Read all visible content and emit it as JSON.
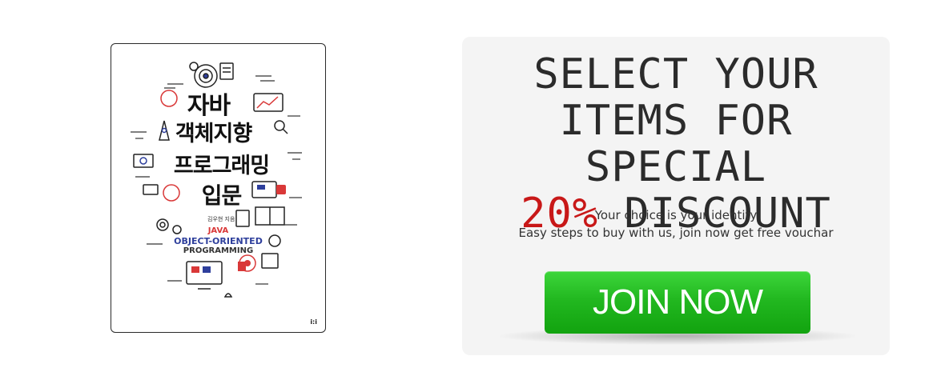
{
  "book": {
    "title_lines": [
      "자바",
      "객체지향",
      "프로그래밍",
      "입문"
    ],
    "author": "김우현 지음",
    "subtitle_lines": [
      "JAVA",
      "OBJECT-ORIENTED",
      "PROGRAMMING"
    ],
    "publisher_logo": "i:i",
    "colors": {
      "accent_red": "#d93838",
      "accent_blue": "#2e3f9c",
      "ink": "#111111"
    }
  },
  "promo": {
    "headline": {
      "line1": "SELECT YOUR",
      "line2": "ITEMS FOR SPECIAL",
      "discount": "20%",
      "line3_rest": " DISCOUNT"
    },
    "subtext": {
      "line1": "Your choice is your identity",
      "line2": "Easy steps to buy with us, join now get free vouchar"
    },
    "cta_label": "JOIN NOW",
    "colors": {
      "discount": "#c81818",
      "button": "#22b820",
      "panel_bg": "#f4f4f4"
    }
  }
}
